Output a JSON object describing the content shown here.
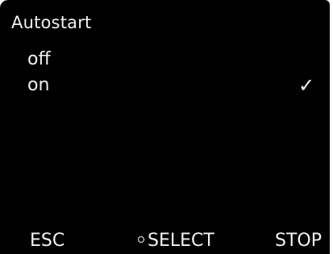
{
  "screen": {
    "title": "Autostart"
  },
  "menu": {
    "items": [
      {
        "label": "off",
        "checked": false
      },
      {
        "label": "on",
        "checked": true,
        "check_glyph": "✓"
      }
    ]
  },
  "footer": {
    "esc_label": "ESC",
    "select_label": "SELECT",
    "select_icon": "circle-icon",
    "stop_label": "STOP"
  },
  "colors": {
    "background": "#000000",
    "text": "#f2f2f2"
  }
}
